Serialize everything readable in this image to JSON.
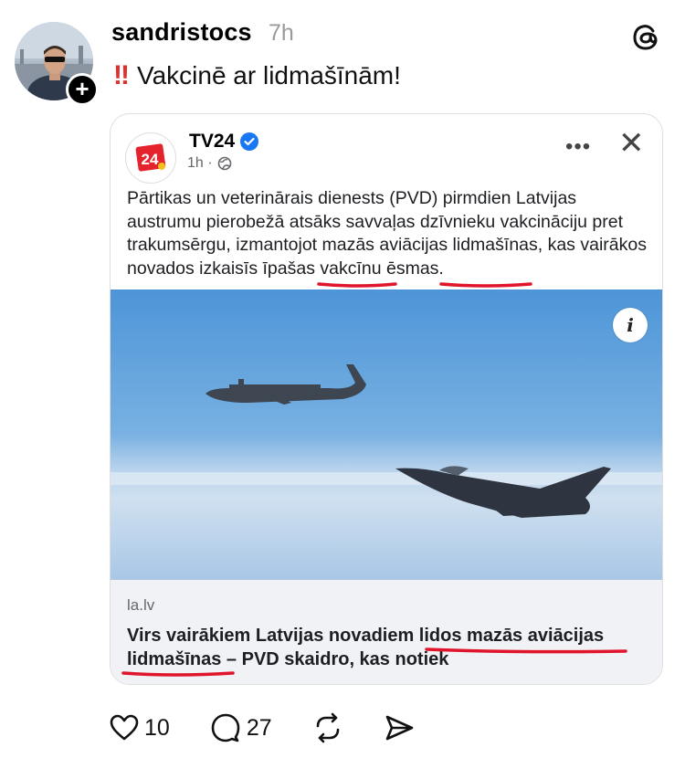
{
  "post": {
    "username": "sandristocs",
    "time": "7h",
    "emoji": "!!",
    "text": "Vakcinē ar lidmašīnām!"
  },
  "embed": {
    "source": "TV24",
    "logo_text": "24",
    "meta_time": "1h ·",
    "article": "Pārtikas un veterinārais dienests (PVD) pirmdien Latvijas austrumu pierobežā atsāks savvaļas dzīvnieku vakcināciju pret trakumsērgu, izmantojot mazās aviācijas lidmašīnas, kas vairākos novados izkaisīs īpašas vakcīnu ēsmas.",
    "link_domain": "la.lv",
    "link_title": "Virs vairākiem Latvijas novadiem lidos mazās aviācijas lidmašīnas – PVD skaidro, kas notiek"
  },
  "actions": {
    "likes": "10",
    "replies": "27"
  },
  "colors": {
    "annotation_red": "#e0152b",
    "verified_blue": "#1877f2",
    "logo_red": "#e5232c"
  }
}
